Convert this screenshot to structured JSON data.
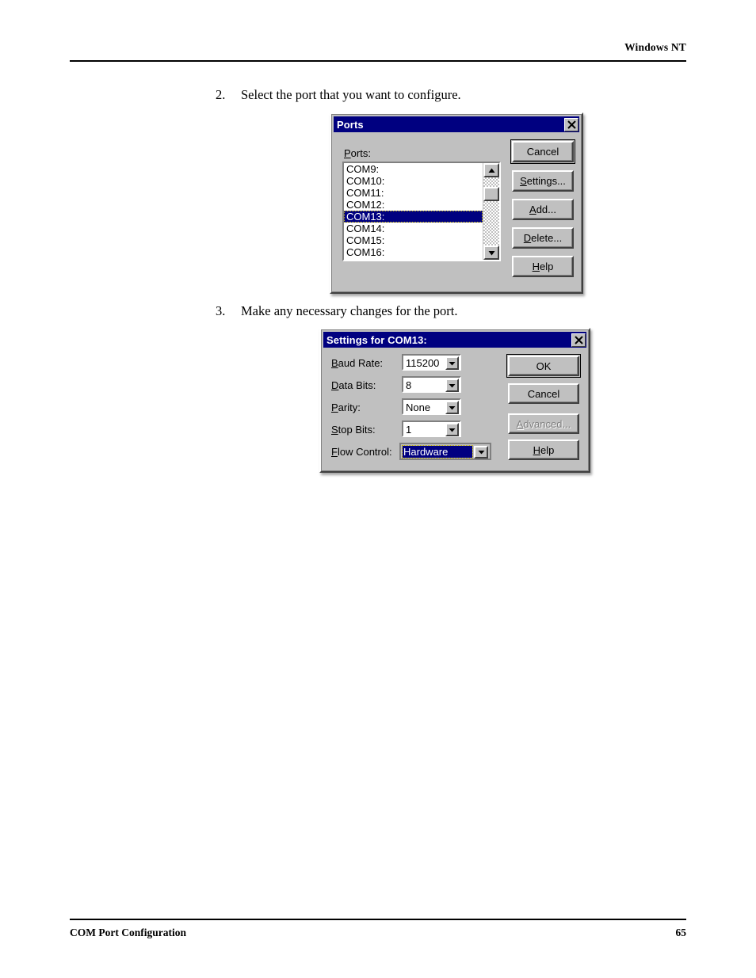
{
  "page": {
    "header_right": "Windows NT",
    "footer_left": "COM Port Configuration",
    "footer_right": "65"
  },
  "steps": [
    {
      "number": "2.",
      "text": "Select the port that you want to configure."
    },
    {
      "number": "3.",
      "text": "Make any necessary changes for the port."
    }
  ],
  "ports_dialog": {
    "title": "Ports",
    "close_label": "×",
    "list_label": "Ports:",
    "items": [
      "COM9:",
      "COM10:",
      "COM11:",
      "COM12:",
      "COM13:",
      "COM14:",
      "COM15:",
      "COM16:"
    ],
    "selected_index": 4,
    "buttons": [
      {
        "label": "Cancel",
        "accel": "",
        "default": true,
        "disabled": false
      },
      {
        "label": "Settings...",
        "accel": "S",
        "default": false,
        "disabled": false
      },
      {
        "label": "Add...",
        "accel": "A",
        "default": false,
        "disabled": false
      },
      {
        "label": "Delete...",
        "accel": "D",
        "default": false,
        "disabled": false
      },
      {
        "label": "Help",
        "accel": "H",
        "default": false,
        "disabled": false
      }
    ]
  },
  "settings_dialog": {
    "title": "Settings for COM13:",
    "close_label": "×",
    "fields": [
      {
        "label": "Baud Rate:",
        "accel": "B",
        "value": "115200",
        "focused": false
      },
      {
        "label": "Data Bits:",
        "accel": "D",
        "value": "8",
        "focused": false
      },
      {
        "label": "Parity:",
        "accel": "P",
        "value": "None",
        "focused": false
      },
      {
        "label": "Stop Bits:",
        "accel": "S",
        "value": "1",
        "focused": false
      },
      {
        "label": "Flow Control:",
        "accel": "F",
        "value": "Hardware",
        "focused": true
      }
    ],
    "buttons": [
      {
        "label": "OK",
        "accel": "",
        "default": true,
        "disabled": false
      },
      {
        "label": "Cancel",
        "accel": "",
        "default": false,
        "disabled": false
      },
      {
        "label": "Advanced...",
        "accel": "A",
        "default": false,
        "disabled": true
      },
      {
        "label": "Help",
        "accel": "H",
        "default": false,
        "disabled": false
      }
    ]
  },
  "colors": {
    "titlebar": "#000080",
    "face": "#c0c0c0",
    "highlight": "#000080",
    "focus_dotted": "#c8b400"
  }
}
